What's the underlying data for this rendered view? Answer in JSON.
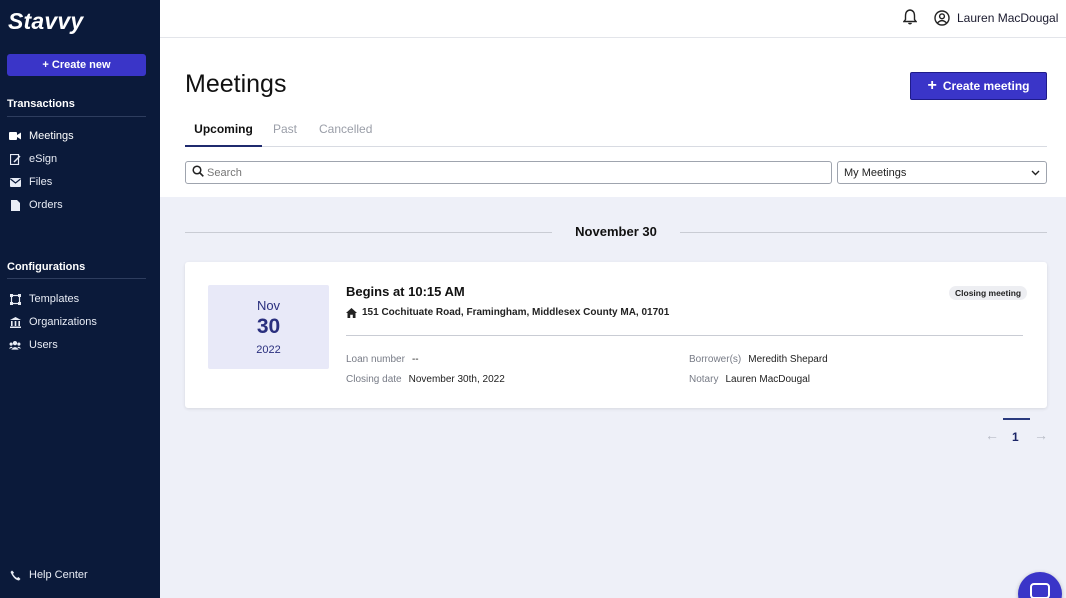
{
  "brand": {
    "name": "Stavvy",
    "accent": "#3a35c8",
    "sidebar_bg": "#0b1a3a"
  },
  "sidebar": {
    "create_new": "+ Create new",
    "transactions_title": "Transactions",
    "transactions": [
      {
        "label": "Meetings",
        "icon": "video-icon"
      },
      {
        "label": "eSign",
        "icon": "sign-icon"
      },
      {
        "label": "Files",
        "icon": "envelope-icon"
      },
      {
        "label": "Orders",
        "icon": "document-icon"
      }
    ],
    "configurations_title": "Configurations",
    "configurations": [
      {
        "label": "Templates",
        "icon": "template-icon"
      },
      {
        "label": "Organizations",
        "icon": "bank-icon"
      },
      {
        "label": "Users",
        "icon": "users-icon"
      }
    ],
    "help": "Help Center"
  },
  "topbar": {
    "user_name": "Lauren MacDougal"
  },
  "main": {
    "title": "Meetings",
    "create_meeting": "Create meeting",
    "tabs": [
      "Upcoming",
      "Past",
      "Cancelled"
    ],
    "active_tab": "Upcoming",
    "search_placeholder": "Search",
    "filter_value": "My Meetings"
  },
  "date_group": "November 30",
  "meeting": {
    "month": "Nov",
    "day": "30",
    "year": "2022",
    "begins": "Begins at 10:15 AM",
    "address": "151 Cochituate Road, Framingham, Middlesex County MA, 01701",
    "badge": "Closing meeting",
    "loan_number_label": "Loan number",
    "loan_number": "--",
    "closing_date_label": "Closing date",
    "closing_date": "November 30th, 2022",
    "borrowers_label": "Borrower(s)",
    "borrowers": "Meredith Shepard",
    "notary_label": "Notary",
    "notary": "Lauren MacDougal"
  },
  "pagination": {
    "current": "1",
    "prev": "←",
    "next": "→"
  }
}
